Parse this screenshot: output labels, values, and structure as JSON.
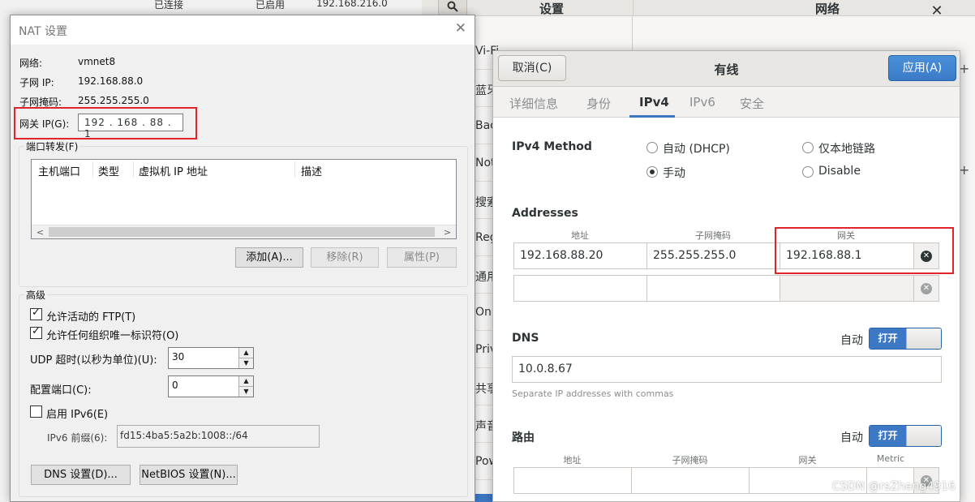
{
  "vm_bg": {
    "row_status": "已连接",
    "row_enabled": "已启用",
    "row_subnet": "192.168.216.0"
  },
  "gnome": {
    "header_title": "设置",
    "header_title2": "网络",
    "sidebar_fragments": [
      "Vi-Fi",
      "蓝牙",
      "Back",
      "Noti",
      "搜索",
      "Regi",
      "通用",
      "Onli",
      "Priva",
      "共享",
      "声音",
      "Pow"
    ]
  },
  "nat": {
    "title": "NAT 设置",
    "network_label": "网络:",
    "network_value": "vmnet8",
    "subnet_ip_label": "子网 IP:",
    "subnet_ip_value": "192.168.88.0",
    "subnet_mask_label": "子网掩码:",
    "subnet_mask_value": "255.255.255.0",
    "gateway_label": "网关 IP(G):",
    "gateway_value": "192 . 168 . 88  .  1",
    "port_forward_title": "端口转发(F)",
    "port_columns": [
      "主机端口",
      "类型",
      "虚拟机 IP 地址",
      "描述"
    ],
    "add_button": "添加(A)...",
    "remove_button": "移除(R)",
    "properties_button": "属性(P)",
    "advanced_title": "高级",
    "allow_ftp": "允许活动的 FTP(T)",
    "allow_uuid": "允许任何组织唯一标识符(O)",
    "udp_timeout_label": "UDP 超时(以秒为单位)(U):",
    "udp_timeout_value": "30",
    "config_port_label": "配置端口(C):",
    "config_port_value": "0",
    "enable_ipv6": "启用 IPv6(E)",
    "ipv6_prefix_label": "IPv6 前缀(6):",
    "ipv6_prefix_value": "fd15:4ba5:5a2b:1008::/64",
    "dns_button": "DNS 设置(D)...",
    "netbios_button": "NetBIOS 设置(N)..."
  },
  "wired": {
    "cancel_button": "取消(C)",
    "title": "有线",
    "apply_button": "应用(A)",
    "tabs": [
      "详细信息",
      "身份",
      "IPv4",
      "IPv6",
      "安全"
    ],
    "ipv4_method_label": "IPv4 Method",
    "method_auto": "自动 (DHCP)",
    "method_link_local": "仅本地链路",
    "method_manual": "手动",
    "method_disable": "Disable",
    "addresses_title": "Addresses",
    "addr_col_address": "地址",
    "addr_col_netmask": "子网掩码",
    "addr_col_gateway": "网关",
    "addr_row1": {
      "address": "192.168.88.20",
      "netmask": "255.255.255.0",
      "gateway": "192.168.88.1"
    },
    "dns_title": "DNS",
    "auto_label": "自动",
    "switch_on": "打开",
    "dns_value": "10.0.8.67",
    "dns_hint": "Separate IP addresses with commas",
    "routes_title": "路由",
    "route_col_metric": "Metric",
    "accent_color": "#3d78c5"
  },
  "watermark": "CSDN @rsZheng4916"
}
